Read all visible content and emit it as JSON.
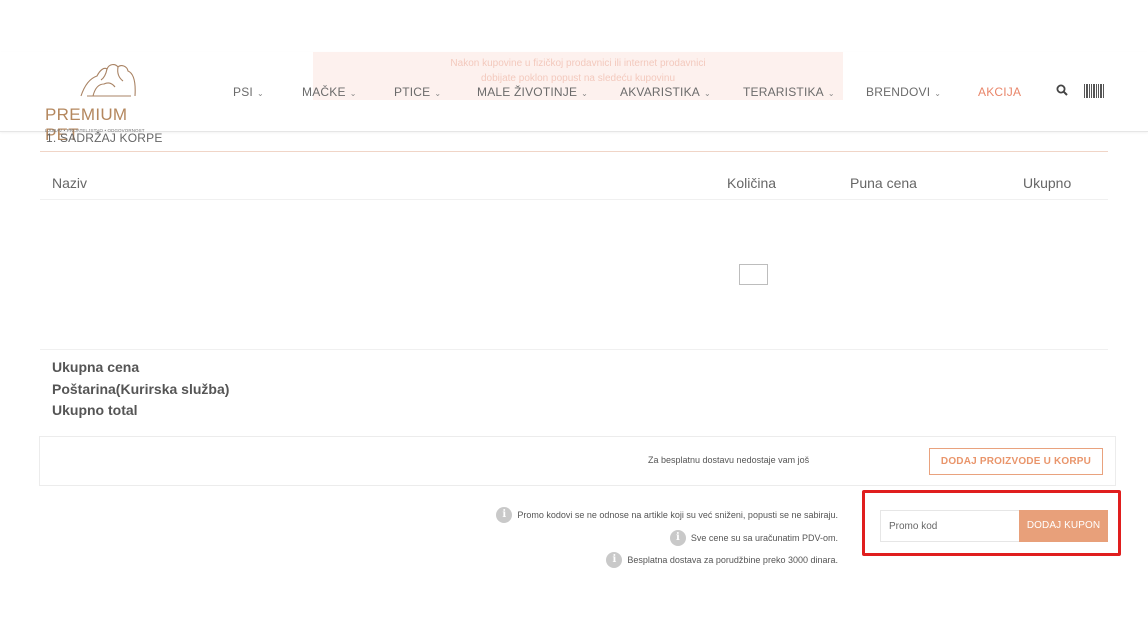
{
  "banner": {
    "line1": "Nakon kupovine u fizičkoj prodavnici ili internet prodavnici",
    "line2": "dobijate poklon popust na sledeću kupovinu"
  },
  "brand": {
    "name": "PREMIUM PET",
    "tagline": "LJUBAV • PRIJATELJSTVO • ODGOVORNOST"
  },
  "nav": {
    "items": [
      {
        "label": "PSI",
        "chevron": "⌄"
      },
      {
        "label": "MAČKE",
        "chevron": "⌄"
      },
      {
        "label": "PTICE",
        "chevron": "⌄"
      },
      {
        "label": "MALE ŽIVOTINJE",
        "chevron": "⌄"
      },
      {
        "label": "AKVARISTIKA",
        "chevron": "⌄"
      },
      {
        "label": "TERARISTIKA",
        "chevron": "⌄"
      },
      {
        "label": "BRENDOVI",
        "chevron": "⌄"
      },
      {
        "label": "AKCIJA",
        "chevron": ""
      }
    ],
    "search_icon": "search-icon",
    "barcode_icon": "barcode-icon"
  },
  "cart": {
    "section_title": "1. SADRŽAJ KORPE",
    "columns": {
      "name": "Naziv",
      "quantity": "Količina",
      "full_price": "Puna cena",
      "total": "Ukupno"
    },
    "summary": {
      "total_price": "Ukupna cena",
      "shipping": "Poštarina(Kurirska služba)",
      "grand_total": "Ukupno total"
    }
  },
  "shipping": {
    "free_text": "Za besplatnu dostavu nedostaje vam još",
    "add_products_label": "DODAJ PROIZVODE U KORPU"
  },
  "info": [
    "Promo kodovi se ne odnose na artikle koji su već sniženi, popusti se ne sabiraju.",
    "Sve cene su sa uračunatim PDV-om.",
    "Besplatna dostava za porudžbine preko 3000 dinara."
  ],
  "promo": {
    "placeholder": "Promo kod",
    "value": "",
    "button_label": "DODAJ KUPON"
  },
  "colors": {
    "accent": "#e8a07a",
    "sale": "#e9866a",
    "highlight": "#e01e1e",
    "brand": "#b4875e"
  }
}
